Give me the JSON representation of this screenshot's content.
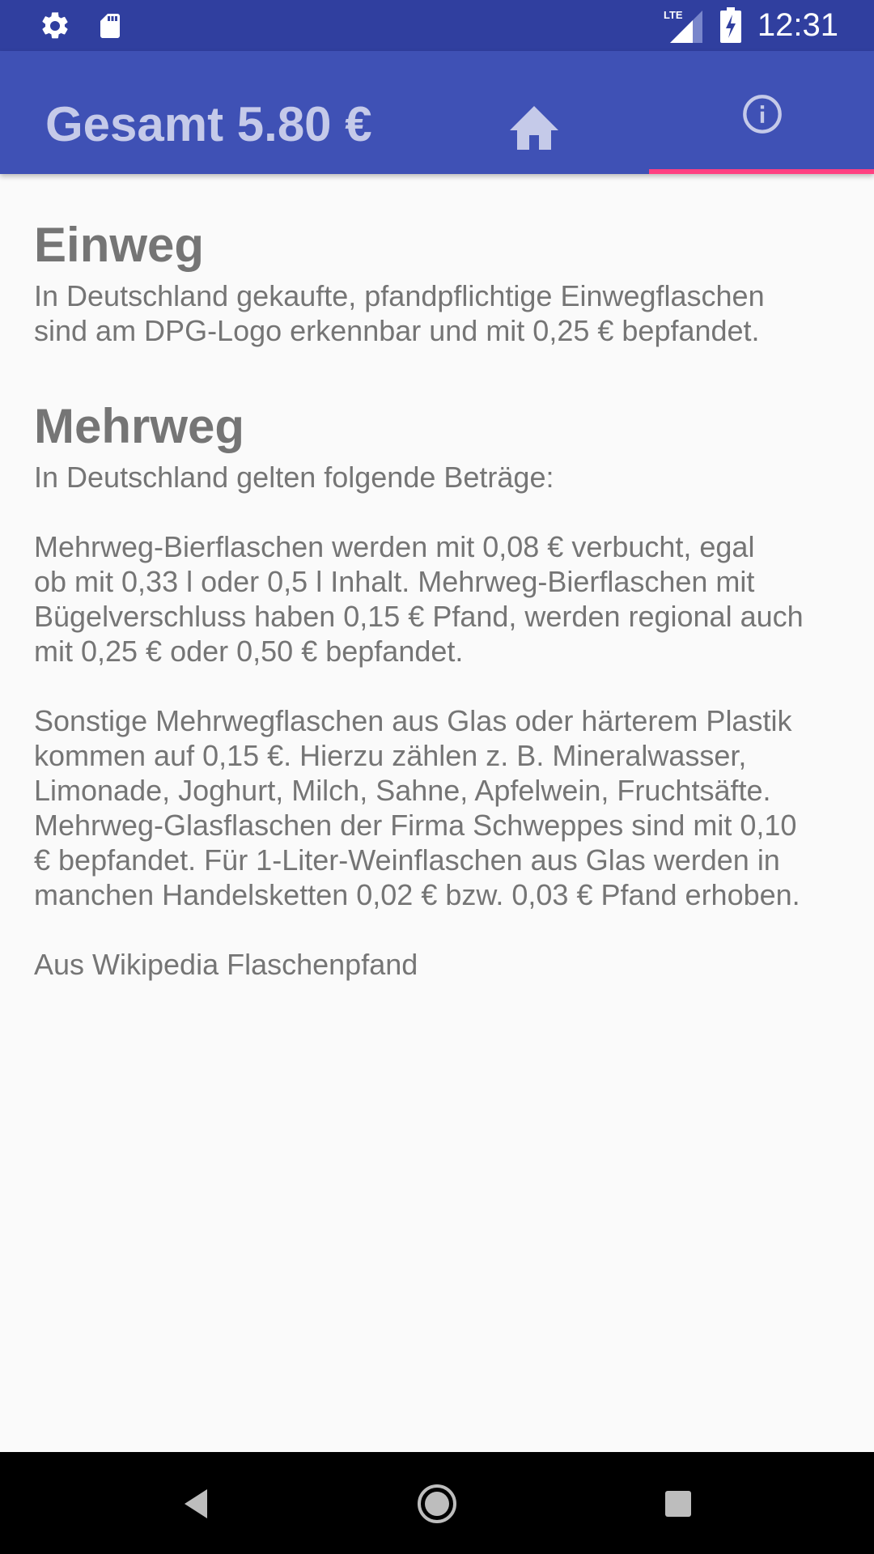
{
  "status_bar": {
    "time": "12:31",
    "network": "LTE",
    "icons": [
      "settings-icon",
      "sd-card-icon",
      "lte-signal-icon",
      "battery-charging-icon"
    ]
  },
  "app_bar": {
    "title": "Gesamt 5.80 €",
    "tabs": [
      {
        "icon": "home-icon",
        "selected": false
      },
      {
        "icon": "info-icon",
        "selected": true
      }
    ],
    "colors": {
      "primary": "#3f51b5",
      "primary_dark": "#303f9f",
      "accent": "#ff4081",
      "title": "#c5cae9"
    }
  },
  "content": {
    "einweg": {
      "heading": "Einweg",
      "text": "In Deutschland gekaufte, pfandpflichtige Einwegflaschen\nsind am DPG-Logo erkennbar und mit 0,25 € bepfandet."
    },
    "mehrweg": {
      "heading": "Mehrweg",
      "text": "In Deutschland gelten folgende Beträge:\n\nMehrweg-Bierflaschen werden mit 0,08 € verbucht, egal\nob mit 0,33 l oder 0,5 l Inhalt. Mehrweg-Bierflaschen mit\nBügelverschluss haben 0,15 € Pfand, werden regional auch\nmit 0,25 € oder 0,50 € bepfandet.\n\nSonstige Mehrwegflaschen aus Glas oder härterem Plastik\nkommen auf 0,15 €. Hierzu zählen z. B. Mineralwasser,\nLimonade, Joghurt, Milch, Sahne, Apfelwein, Fruchtsäfte.\nMehrweg-Glasflaschen der Firma Schweppes sind mit 0,10\n€ bepfandet. Für 1-Liter-Weinflaschen aus Glas werden in\nmanchen Handelsketten 0,02 € bzw. 0,03 € Pfand erhoben.\n\nAus Wikipedia Flaschenpfand"
    }
  },
  "nav_bar": {
    "buttons": [
      "back-icon",
      "home-circle-icon",
      "recents-icon"
    ]
  }
}
